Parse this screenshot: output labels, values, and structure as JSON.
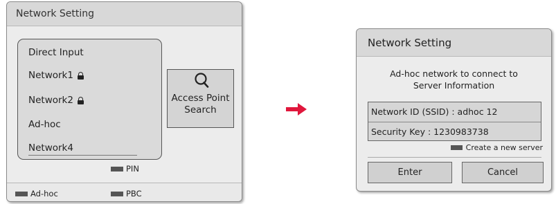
{
  "left_dialog": {
    "title": "Network Setting",
    "network_list": [
      {
        "label": "Direct Input",
        "locked": false
      },
      {
        "label": "Network1",
        "locked": true
      },
      {
        "label": "Network2",
        "locked": true
      },
      {
        "label": "Ad-hoc",
        "locked": false
      },
      {
        "label": "Network4",
        "locked": false
      }
    ],
    "ap_search": {
      "line1": "Access Point",
      "line2": "Search",
      "icon": "magnifier-icon"
    },
    "keys": {
      "pin": "PIN",
      "adhoc": "Ad-hoc",
      "pbc": "PBC"
    }
  },
  "right_dialog": {
    "title": "Network Setting",
    "message_line1": "Ad-hoc network to connect to",
    "message_line2": "Server Information",
    "network_id": "Network ID (SSID) : adhoc 12",
    "security_key": "Security Key : 1230983738",
    "create_server": "Create a new server",
    "enter_label": "Enter",
    "cancel_label": "Cancel"
  },
  "colors": {
    "arrow": "#e0173c",
    "dialog_bg": "#ececec",
    "title_bg": "#d8d8d8",
    "key_swatch": "#555555"
  }
}
